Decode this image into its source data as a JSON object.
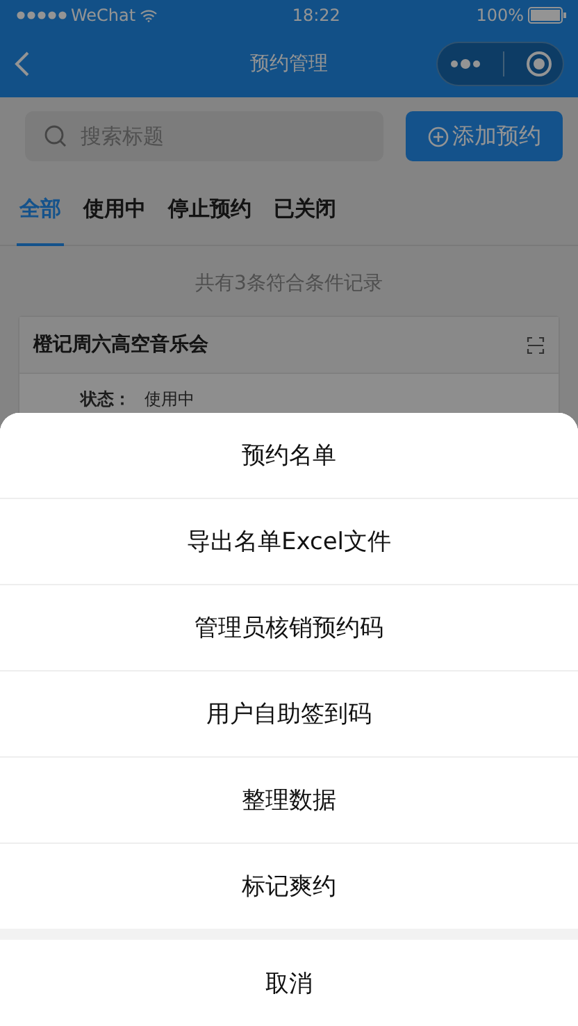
{
  "status_bar": {
    "carrier": "WeChat",
    "time": "18:22",
    "battery": "100%"
  },
  "nav": {
    "title": "预约管理"
  },
  "search": {
    "placeholder": "搜索标题"
  },
  "add_button": {
    "label": "添加预约"
  },
  "tabs": [
    {
      "label": "全部",
      "selected": true
    },
    {
      "label": "使用中",
      "selected": false
    },
    {
      "label": "停止预约",
      "selected": false
    },
    {
      "label": "已关闭",
      "selected": false
    }
  ],
  "summary": "共有3条符合条件记录",
  "card": {
    "title": "橙记周六高空音乐会",
    "status_label": "状态：",
    "status_value": "使用中"
  },
  "action_sheet": {
    "items": [
      "预约名单",
      "导出名单Excel文件",
      "管理员核销预约码",
      "用户自助签到码",
      "整理数据",
      "标记爽约"
    ],
    "cancel": "取消"
  }
}
